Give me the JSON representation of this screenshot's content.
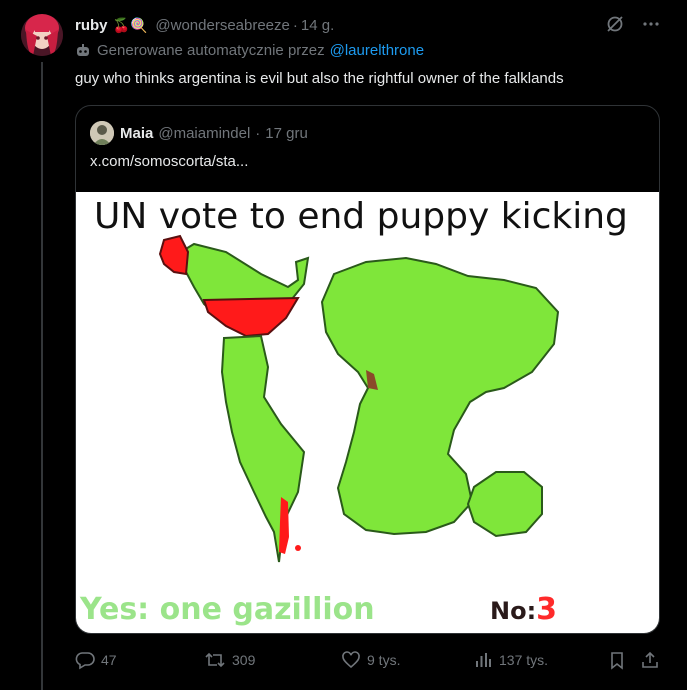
{
  "tweet": {
    "author_name": "ruby",
    "author_emoji": "🍒🍭",
    "author_handle": "@wonderseabreeze",
    "separator": "·",
    "time": "14 g.",
    "auto_generated_label": "Generowane automatycznie przez",
    "auto_generated_link": "@laurelthrone",
    "text": "guy who thinks argentina is evil but also the rightful owner of the falklands"
  },
  "quote": {
    "author_name": "Maia",
    "author_handle": "@maiamindel",
    "separator": "·",
    "time": "17 gru",
    "text": "x.com/somoscorta/sta...",
    "meme": {
      "title": "UN vote to end puppy kicking",
      "yes_text": "Yes: one gazillion",
      "no_label": "No:",
      "no_value": "3"
    }
  },
  "actions": {
    "reply_count": "47",
    "retweet_count": "309",
    "like_count": "9 tys.",
    "view_count": "137 tys."
  },
  "icons": [
    "avatar",
    "grok-icon",
    "more-icon",
    "robot-icon",
    "reply-icon",
    "retweet-icon",
    "like-icon",
    "views-icon",
    "bookmark-icon",
    "share-icon"
  ],
  "colors": {
    "background": "#000000",
    "text": "#e7e9ea",
    "muted": "#71767b",
    "link": "#1d9bf0",
    "map_green": "#7fe63a",
    "map_red": "#ff1a1a"
  }
}
